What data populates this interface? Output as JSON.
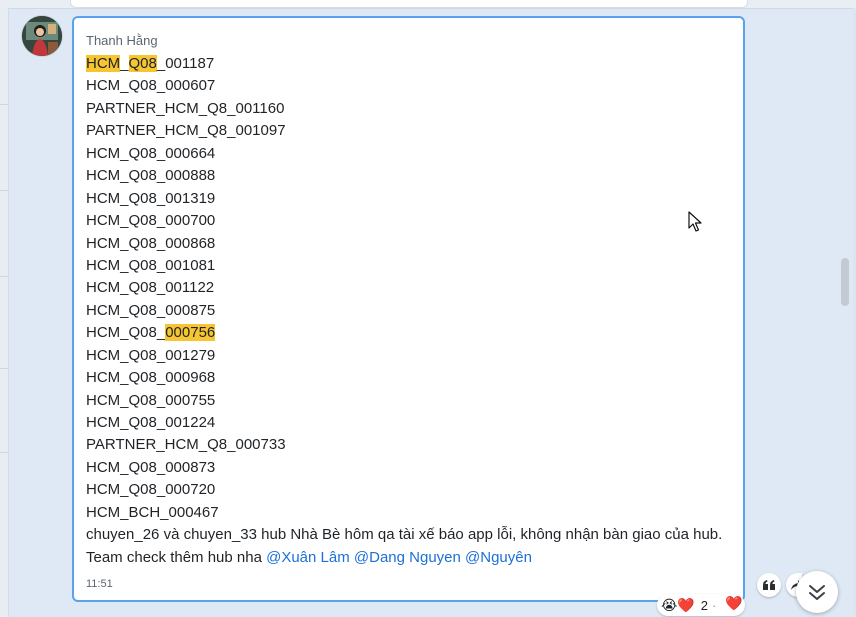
{
  "message": {
    "sender": "Thanh Hằng",
    "time": "11:51",
    "lines": [
      [
        {
          "t": "HCM",
          "hl": true
        },
        {
          "t": "_"
        },
        {
          "t": "Q08",
          "hl": true
        },
        {
          "t": "_001187"
        }
      ],
      [
        {
          "t": "HCM_Q08_000607"
        }
      ],
      [
        {
          "t": "PARTNER_HCM_Q8_001160"
        }
      ],
      [
        {
          "t": "PARTNER_HCM_Q8_001097"
        }
      ],
      [
        {
          "t": "HCM_Q08_000664"
        }
      ],
      [
        {
          "t": "HCM_Q08_000888"
        }
      ],
      [
        {
          "t": "HCM_Q08_001319"
        }
      ],
      [
        {
          "t": "HCM_Q08_000700"
        }
      ],
      [
        {
          "t": "HCM_Q08_000868"
        }
      ],
      [
        {
          "t": "HCM_Q08_001081"
        }
      ],
      [
        {
          "t": "HCM_Q08_001122"
        }
      ],
      [
        {
          "t": "HCM_Q08_000875"
        }
      ],
      [
        {
          "t": "HCM_Q08_"
        },
        {
          "t": "000756",
          "hl": true
        }
      ],
      [
        {
          "t": "HCM_Q08_001279"
        }
      ],
      [
        {
          "t": "HCM_Q08_000968"
        }
      ],
      [
        {
          "t": "HCM_Q08_000755"
        }
      ],
      [
        {
          "t": "HCM_Q08_001224"
        }
      ],
      [
        {
          "t": "PARTNER_HCM_Q8_000733"
        }
      ],
      [
        {
          "t": "HCM_Q08_000873"
        }
      ],
      [
        {
          "t": "HCM_Q08_000720"
        }
      ],
      [
        {
          "t": "HCM_BCH_000467"
        }
      ],
      [
        {
          "t": "chuyen_26 và chuyen_33 hub Nhà Bè hôm qa tài xế báo app lỗi, không nhận bàn giao của hub."
        }
      ],
      [
        {
          "t": "Team check thêm hub nha "
        },
        {
          "t": "@Xuân Lâm",
          "mention": true
        },
        {
          "t": " "
        },
        {
          "t": "@Dang Nguyen",
          "mention": true
        },
        {
          "t": " "
        },
        {
          "t": "@Nguyên",
          "mention": true
        }
      ]
    ]
  },
  "reactions": {
    "emojis": [
      "😭",
      "❤️"
    ],
    "count": "2",
    "quick_reaction": "❤️"
  },
  "actions": {
    "quote_icon": "quote-icon",
    "share_icon": "share-icon"
  },
  "icons": {
    "scroll_down": "double-chevron-down-icon"
  },
  "colors": {
    "highlight": "#f7c531",
    "mention": "#1d70d6",
    "bubble_border": "#5aa3ec"
  }
}
